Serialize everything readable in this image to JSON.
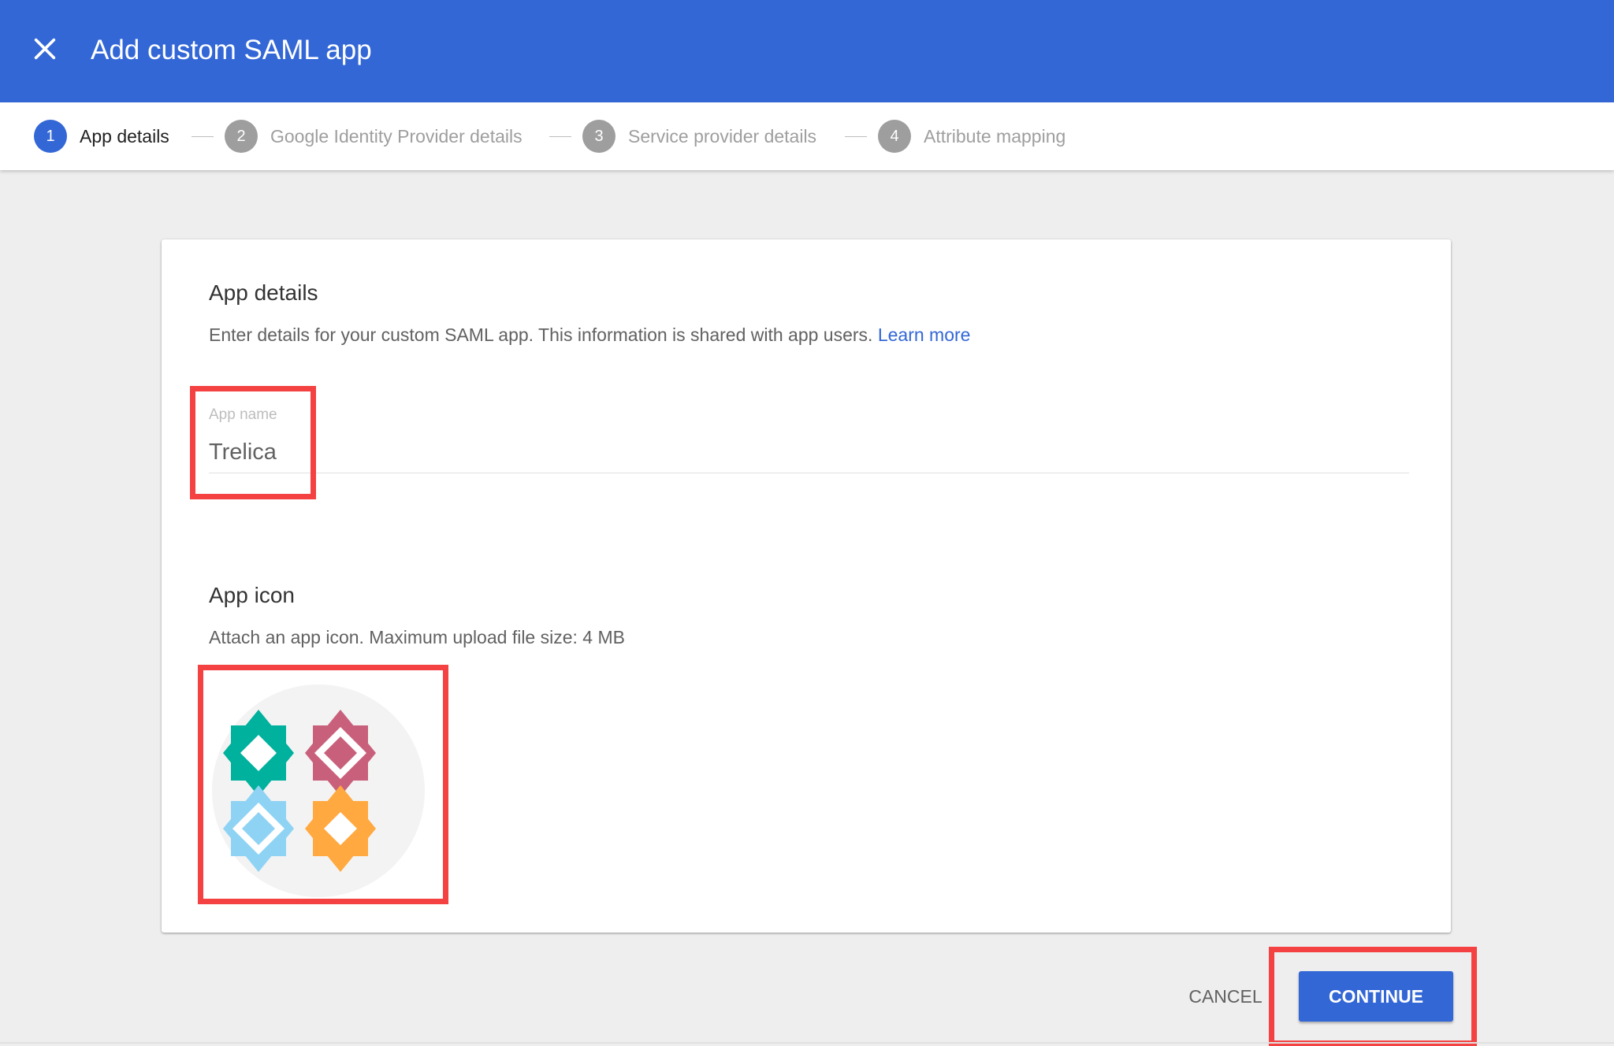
{
  "header": {
    "title": "Add custom SAML app",
    "close_icon": "close-icon"
  },
  "stepper": {
    "steps": [
      {
        "number": "1",
        "label": "App details",
        "active": true
      },
      {
        "number": "2",
        "label": "Google Identity Provider details",
        "active": false
      },
      {
        "number": "3",
        "label": "Service provider details",
        "active": false
      },
      {
        "number": "4",
        "label": "Attribute mapping",
        "active": false
      }
    ]
  },
  "app_details": {
    "title": "App details",
    "description": "Enter details for your custom SAML app. This information is shared with app users.",
    "learn_more": "Learn more",
    "field_label": "App name",
    "field_value": "Trelica"
  },
  "app_icon": {
    "title": "App icon",
    "description": "Attach an app icon. Maximum upload file size: 4 MB",
    "tile_colors": [
      "#00b19d",
      "#c9607b",
      "#8fd3f4",
      "#ffa940"
    ]
  },
  "actions": {
    "cancel": "CANCEL",
    "continue": "CONTINUE"
  },
  "colors": {
    "primary": "#3367d6",
    "highlight": "#f44242"
  }
}
